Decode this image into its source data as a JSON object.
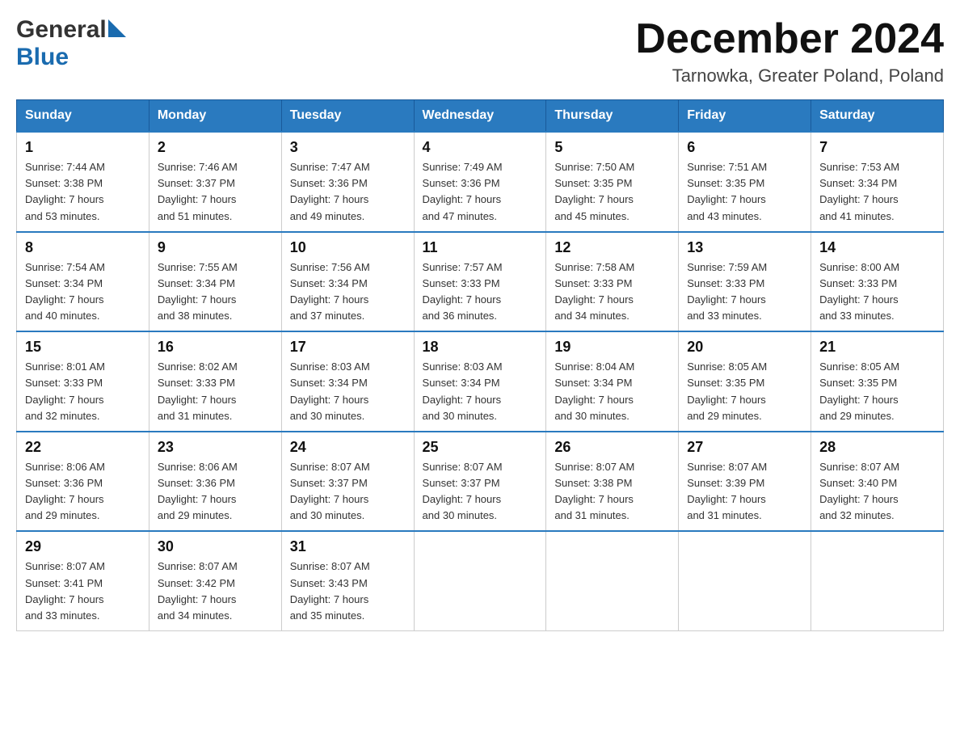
{
  "logo": {
    "general": "General",
    "blue": "Blue"
  },
  "header": {
    "month": "December 2024",
    "location": "Tarnowka, Greater Poland, Poland"
  },
  "weekdays": [
    "Sunday",
    "Monday",
    "Tuesday",
    "Wednesday",
    "Thursday",
    "Friday",
    "Saturday"
  ],
  "weeks": [
    [
      {
        "day": "1",
        "sunrise": "7:44 AM",
        "sunset": "3:38 PM",
        "daylight": "7 hours and 53 minutes."
      },
      {
        "day": "2",
        "sunrise": "7:46 AM",
        "sunset": "3:37 PM",
        "daylight": "7 hours and 51 minutes."
      },
      {
        "day": "3",
        "sunrise": "7:47 AM",
        "sunset": "3:36 PM",
        "daylight": "7 hours and 49 minutes."
      },
      {
        "day": "4",
        "sunrise": "7:49 AM",
        "sunset": "3:36 PM",
        "daylight": "7 hours and 47 minutes."
      },
      {
        "day": "5",
        "sunrise": "7:50 AM",
        "sunset": "3:35 PM",
        "daylight": "7 hours and 45 minutes."
      },
      {
        "day": "6",
        "sunrise": "7:51 AM",
        "sunset": "3:35 PM",
        "daylight": "7 hours and 43 minutes."
      },
      {
        "day": "7",
        "sunrise": "7:53 AM",
        "sunset": "3:34 PM",
        "daylight": "7 hours and 41 minutes."
      }
    ],
    [
      {
        "day": "8",
        "sunrise": "7:54 AM",
        "sunset": "3:34 PM",
        "daylight": "7 hours and 40 minutes."
      },
      {
        "day": "9",
        "sunrise": "7:55 AM",
        "sunset": "3:34 PM",
        "daylight": "7 hours and 38 minutes."
      },
      {
        "day": "10",
        "sunrise": "7:56 AM",
        "sunset": "3:34 PM",
        "daylight": "7 hours and 37 minutes."
      },
      {
        "day": "11",
        "sunrise": "7:57 AM",
        "sunset": "3:33 PM",
        "daylight": "7 hours and 36 minutes."
      },
      {
        "day": "12",
        "sunrise": "7:58 AM",
        "sunset": "3:33 PM",
        "daylight": "7 hours and 34 minutes."
      },
      {
        "day": "13",
        "sunrise": "7:59 AM",
        "sunset": "3:33 PM",
        "daylight": "7 hours and 33 minutes."
      },
      {
        "day": "14",
        "sunrise": "8:00 AM",
        "sunset": "3:33 PM",
        "daylight": "7 hours and 33 minutes."
      }
    ],
    [
      {
        "day": "15",
        "sunrise": "8:01 AM",
        "sunset": "3:33 PM",
        "daylight": "7 hours and 32 minutes."
      },
      {
        "day": "16",
        "sunrise": "8:02 AM",
        "sunset": "3:33 PM",
        "daylight": "7 hours and 31 minutes."
      },
      {
        "day": "17",
        "sunrise": "8:03 AM",
        "sunset": "3:34 PM",
        "daylight": "7 hours and 30 minutes."
      },
      {
        "day": "18",
        "sunrise": "8:03 AM",
        "sunset": "3:34 PM",
        "daylight": "7 hours and 30 minutes."
      },
      {
        "day": "19",
        "sunrise": "8:04 AM",
        "sunset": "3:34 PM",
        "daylight": "7 hours and 30 minutes."
      },
      {
        "day": "20",
        "sunrise": "8:05 AM",
        "sunset": "3:35 PM",
        "daylight": "7 hours and 29 minutes."
      },
      {
        "day": "21",
        "sunrise": "8:05 AM",
        "sunset": "3:35 PM",
        "daylight": "7 hours and 29 minutes."
      }
    ],
    [
      {
        "day": "22",
        "sunrise": "8:06 AM",
        "sunset": "3:36 PM",
        "daylight": "7 hours and 29 minutes."
      },
      {
        "day": "23",
        "sunrise": "8:06 AM",
        "sunset": "3:36 PM",
        "daylight": "7 hours and 29 minutes."
      },
      {
        "day": "24",
        "sunrise": "8:07 AM",
        "sunset": "3:37 PM",
        "daylight": "7 hours and 30 minutes."
      },
      {
        "day": "25",
        "sunrise": "8:07 AM",
        "sunset": "3:37 PM",
        "daylight": "7 hours and 30 minutes."
      },
      {
        "day": "26",
        "sunrise": "8:07 AM",
        "sunset": "3:38 PM",
        "daylight": "7 hours and 31 minutes."
      },
      {
        "day": "27",
        "sunrise": "8:07 AM",
        "sunset": "3:39 PM",
        "daylight": "7 hours and 31 minutes."
      },
      {
        "day": "28",
        "sunrise": "8:07 AM",
        "sunset": "3:40 PM",
        "daylight": "7 hours and 32 minutes."
      }
    ],
    [
      {
        "day": "29",
        "sunrise": "8:07 AM",
        "sunset": "3:41 PM",
        "daylight": "7 hours and 33 minutes."
      },
      {
        "day": "30",
        "sunrise": "8:07 AM",
        "sunset": "3:42 PM",
        "daylight": "7 hours and 34 minutes."
      },
      {
        "day": "31",
        "sunrise": "8:07 AM",
        "sunset": "3:43 PM",
        "daylight": "7 hours and 35 minutes."
      },
      null,
      null,
      null,
      null
    ]
  ]
}
